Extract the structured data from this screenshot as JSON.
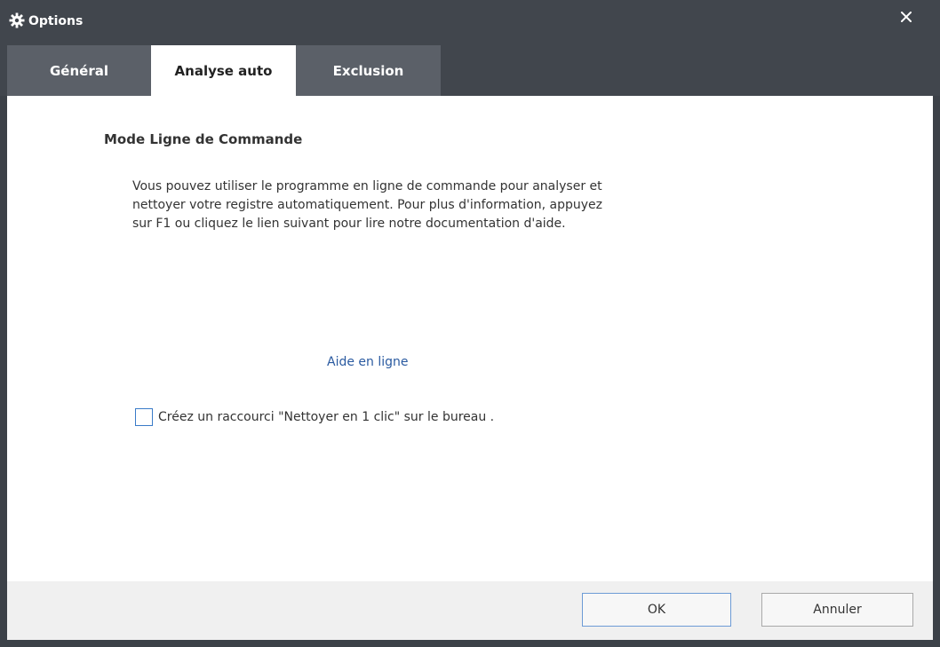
{
  "window": {
    "title": "Options",
    "title_icon": "gear-icon",
    "close_icon": "close-icon"
  },
  "tabs": [
    {
      "label": "Général",
      "active": false
    },
    {
      "label": "Analyse auto",
      "active": true
    },
    {
      "label": "Exclusion",
      "active": false
    }
  ],
  "content": {
    "section_title": "Mode Ligne de Commande",
    "description_lines": [
      "Vous pouvez utiliser le programme en ligne de commande pour analyser et",
      "nettoyer votre registre automatiquement. Pour plus d'information, appuyez",
      "sur F1 ou cliquez le lien suivant pour lire notre documentation d'aide."
    ],
    "help_link": "Aide en ligne",
    "shortcut_checkbox": {
      "label": "Créez un raccourci \"Nettoyer en 1 clic\" sur le bureau .",
      "checked": false
    }
  },
  "footer": {
    "ok_label": "OK",
    "cancel_label": "Annuler"
  },
  "colors": {
    "titlebar": "#41464d",
    "inactive_tab": "#5b6068",
    "link": "#2a5aa0",
    "checkbox_border": "#3a7bc8"
  }
}
